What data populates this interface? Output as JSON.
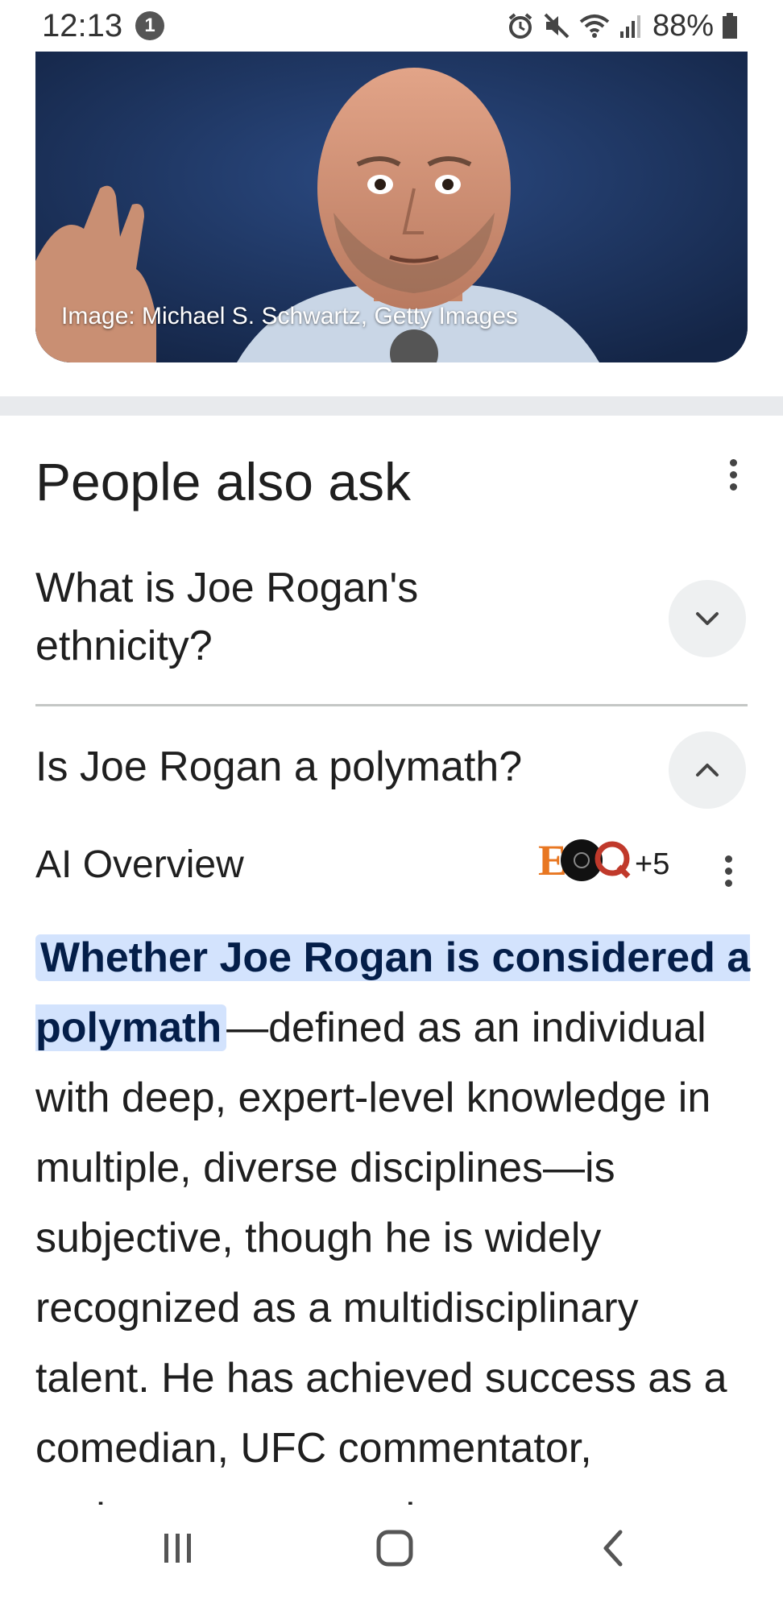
{
  "status_bar": {
    "time": "12:13",
    "notification_count": "1",
    "battery": "88%",
    "icons": [
      "alarm-icon",
      "mute-icon",
      "wifi-icon",
      "signal-icon",
      "battery-icon"
    ]
  },
  "image_card": {
    "credit": "Image: Michael S. Schwartz, Getty Images"
  },
  "people_also_ask": {
    "title": "People also ask",
    "questions": [
      {
        "text": "What is Joe Rogan's ethnicity?",
        "expanded": false
      },
      {
        "text": "Is Joe Rogan a polymath?",
        "expanded": true
      }
    ]
  },
  "ai_overview": {
    "label": "AI Overview",
    "sources_more": "+5",
    "highlight": "Whether Joe Rogan is considered a polymath",
    "body": "—defined as an individual with deep, expert-level knowledge in multiple, diverse disciplines—is subjective, though he is widely recognized as a multidisciplinary talent. He has achieved success as a comedian, UFC commentator, podcaster, actor and"
  },
  "colors": {
    "highlight_bg": "#d3e3fd",
    "highlight_text": "#041e49",
    "divider": "#e8eaed"
  }
}
